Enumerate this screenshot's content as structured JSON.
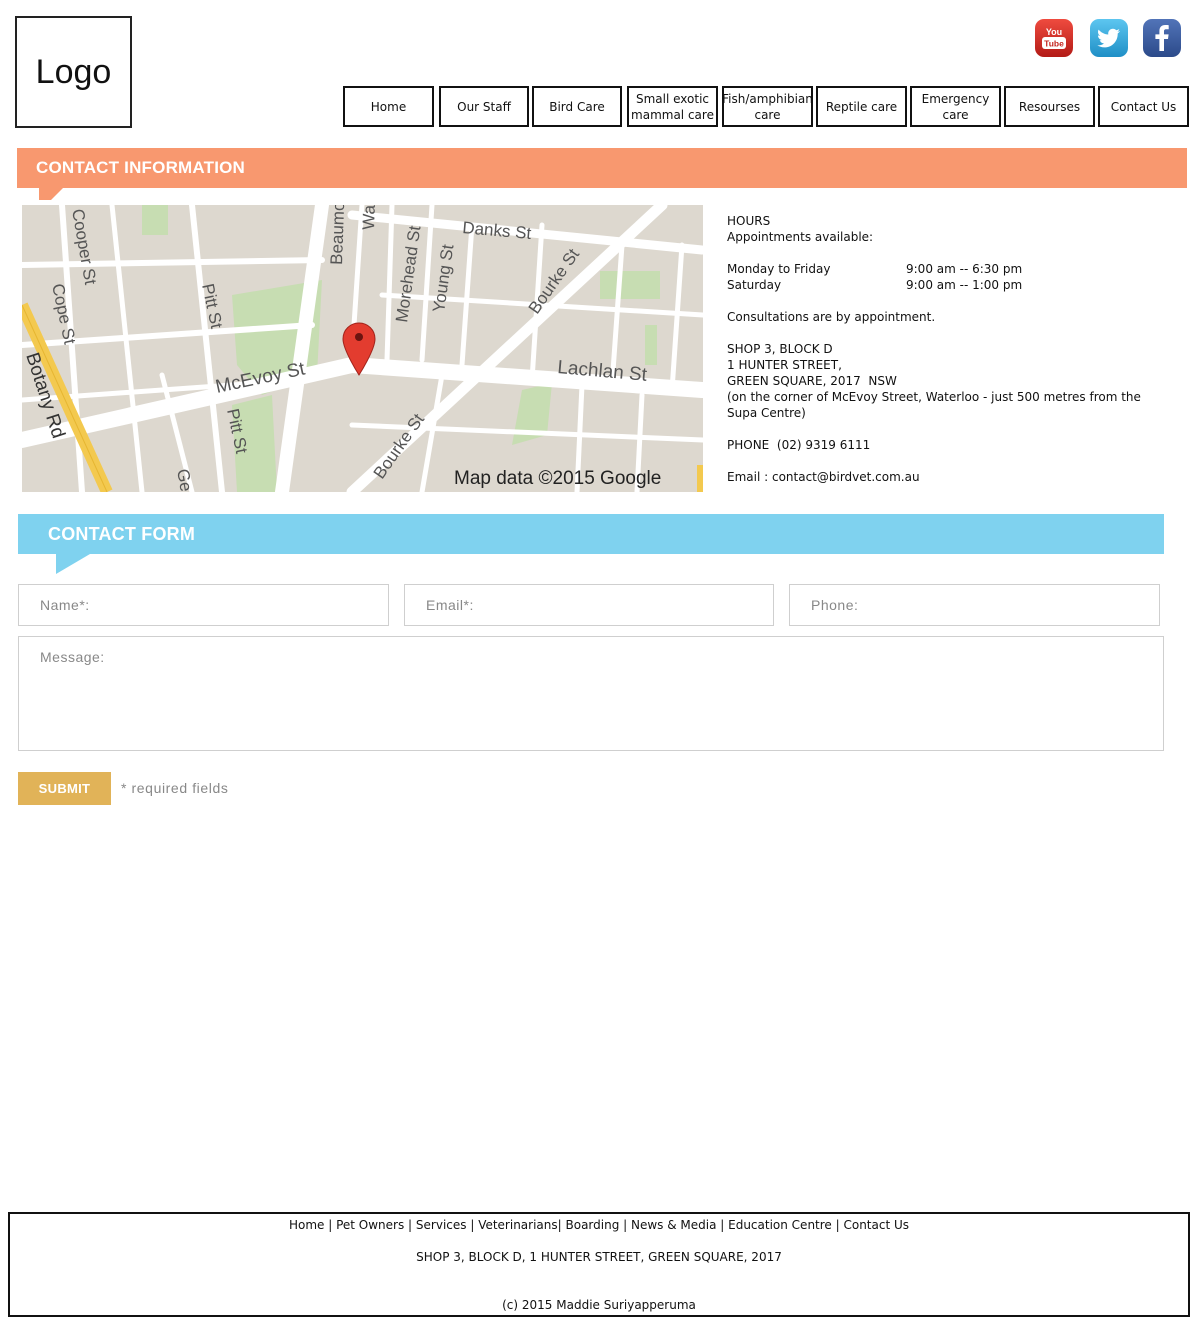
{
  "header": {
    "logo_text": "Logo",
    "social": [
      {
        "name": "youtube",
        "label": "You Tube",
        "color": "#d42a24"
      },
      {
        "name": "twitter",
        "color": "#2fa7dc"
      },
      {
        "name": "facebook",
        "color": "#3b5998"
      }
    ]
  },
  "nav": {
    "items": [
      {
        "label": "Home"
      },
      {
        "label": "Our Staff"
      },
      {
        "label": "Bird Care"
      },
      {
        "label": "Small exotic mammal care"
      },
      {
        "label": "Fish/amphibian care"
      },
      {
        "label": "Reptile care"
      },
      {
        "label": "Emergency care"
      },
      {
        "label": "Resourses"
      },
      {
        "label": "Contact Us"
      }
    ]
  },
  "contact_section": {
    "title": "CONTACT INFORMATION",
    "accent": "#f8986f",
    "map": {
      "streets": [
        "Danks St",
        "Bourke St",
        "Beaumont St",
        "Walker St",
        "Morehead St",
        "Young St",
        "McEvoy St",
        "Lachlan St",
        "Botany Rd",
        "Pitt St",
        "Cope St",
        "Cooper St",
        "George St"
      ],
      "attribution": "Map data ©2015 Google"
    },
    "hours_heading": "HOURS",
    "appointments": "Appointments available:",
    "schedule": [
      {
        "days": "Monday to Friday",
        "time": "9:00 am -- 6:30 pm"
      },
      {
        "days": "Saturday",
        "time": "9:00 am -- 1:00 pm"
      }
    ],
    "consultations": "Consultations are by appointment.",
    "address_lines": [
      "SHOP 3, BLOCK D",
      "1 HUNTER STREET,",
      "GREEN SQUARE, 2017  NSW",
      "(on the corner of McEvoy Street, Waterloo - just 500 metres from the Supa Centre)"
    ],
    "phone": "PHONE  (02) 9319 6111",
    "email": "Email : contact@birdvet.com.au"
  },
  "form_section": {
    "title": "CONTACT FORM",
    "accent": "#7fd2ef",
    "name_placeholder": "Name*:",
    "email_placeholder": "Email*:",
    "phone_placeholder": "Phone:",
    "message_placeholder": "Message:",
    "submit_label": "SUBMIT",
    "submit_color": "#e1b358",
    "required_note": "* required fields"
  },
  "footer": {
    "links": [
      "Home",
      "Pet Owners",
      "Services",
      "Veterinarians",
      "Boarding",
      "News & Media",
      "Education Centre",
      "Contact Us"
    ],
    "address": "SHOP 3, BLOCK D, 1 HUNTER STREET, GREEN SQUARE, 2017",
    "copyright": "(c) 2015 Maddie Suriyapperuma"
  }
}
